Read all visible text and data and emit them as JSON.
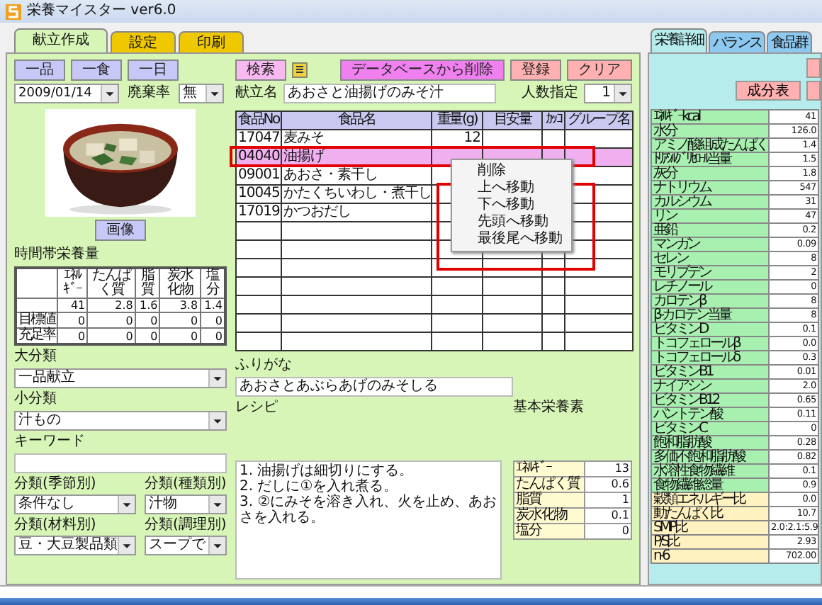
{
  "window": {
    "title": "栄養マイスター ver6.0"
  },
  "tabs": [
    {
      "label": "献立作成",
      "selected": true
    },
    {
      "label": "設定",
      "selected": false
    },
    {
      "label": "印刷",
      "selected": false
    }
  ],
  "period_buttons": [
    "一品",
    "一食",
    "一日"
  ],
  "search_button": "検索",
  "date": "2009/01/14",
  "waste_rate": {
    "label": "廃棄率",
    "value": "無"
  },
  "image_button": "画像",
  "time_nutrition": {
    "title": "時間帯栄養量",
    "columns": [
      "ｴﾈﾙｷﾞｰ",
      "たんぱく質",
      "脂質",
      "炭水化物",
      "塩分"
    ],
    "rows": [
      {
        "label": "",
        "values": [
          "41",
          "2.8",
          "1.6",
          "3.8",
          "1.4"
        ]
      },
      {
        "label": "目標値",
        "values": [
          "0",
          "0",
          "0",
          "0",
          "0"
        ]
      },
      {
        "label": "充足率",
        "values": [
          "0",
          "0",
          "0",
          "0",
          "0"
        ]
      }
    ]
  },
  "classification": [
    {
      "label": "大分類",
      "value": "一品献立",
      "kind": "dropdown"
    },
    {
      "label": "小分類",
      "value": "汁もの",
      "kind": "dropdown"
    },
    {
      "label": "キーワード",
      "kind": "text"
    }
  ],
  "sub_classification": [
    {
      "label": "分類(季節別)",
      "value": "条件なし"
    },
    {
      "label": "分類(種類別)",
      "value": "汁物"
    },
    {
      "label": "分類(材料別)",
      "value": "豆・大豆製品類"
    },
    {
      "label": "分類(調理別)",
      "value": "スープで"
    }
  ],
  "action_buttons": [
    {
      "label": "データベースから削除",
      "kind": "danger"
    },
    {
      "label": "登録",
      "kind": "normal"
    },
    {
      "label": "クリア",
      "kind": "normal"
    }
  ],
  "menu_name": {
    "label": "献立名",
    "value": "あおさと油揚げのみそ汁"
  },
  "servings": {
    "label": "人数指定",
    "value": "1"
  },
  "food_table": {
    "columns": [
      "食品No",
      "食品名",
      "重量(g)",
      "目安量",
      "ｶｯｺ",
      "グループ名"
    ],
    "rows": [
      {
        "no": "17047",
        "name": "麦みそ",
        "weight": "12",
        "selected": false
      },
      {
        "no": "04040",
        "name": "油揚げ",
        "selected": true
      },
      {
        "no": "09001",
        "name": "あおさ・素干し",
        "selected": false
      },
      {
        "no": "10045",
        "name": "かたくちいわし・煮干し",
        "selected": false
      },
      {
        "no": "17019",
        "name": "かつおだし",
        "selected": false
      }
    ]
  },
  "context_menu": [
    "削除",
    "上へ移動",
    "下へ移動",
    "先頭へ移動",
    "最後尾へ移動"
  ],
  "furigana": {
    "label": "ふりがな",
    "value": "あおさとあぶらあげのみそしる"
  },
  "recipe": {
    "label": "レシピ",
    "lines": [
      "1. 油揚げは細切りにする。",
      "2. だしに①を入れ煮る。",
      "3. ②にみそを溶き入れ、火を止め、あおさを入れる。"
    ]
  },
  "basic_nutrients": {
    "title": "基本栄養素",
    "rows": [
      {
        "name": "ｴﾈﾙｷﾞｰ",
        "value": "13"
      },
      {
        "name": "たんぱく質",
        "value": "0.6"
      },
      {
        "name": "脂質",
        "value": "1"
      },
      {
        "name": "炭水化物",
        "value": "0.1"
      },
      {
        "name": "塩分",
        "value": "0"
      }
    ]
  },
  "detail_tabs": [
    {
      "label": "栄養詳細",
      "selected": true
    },
    {
      "label": "バランス",
      "selected": false
    },
    {
      "label": "食品群",
      "selected": false
    }
  ],
  "detail_button": "成分表",
  "nutrient_details": [
    {
      "name": "ｴﾈﾙｷﾞｰkcal",
      "value": "41",
      "kind": "main"
    },
    {
      "name": "水分",
      "value": "126.0",
      "kind": "main"
    },
    {
      "name": "アミノ酸組成たんぱく",
      "value": "1.4",
      "kind": "main"
    },
    {
      "name": "ﾄﾘｱｼﾙｸﾞﾘｾﾛｰﾙ当量",
      "value": "1.5",
      "kind": "main"
    },
    {
      "name": "灰分",
      "value": "1.8",
      "kind": "main"
    },
    {
      "name": "ナトリウム",
      "value": "547",
      "kind": "main"
    },
    {
      "name": "カルシウム",
      "value": "31",
      "kind": "main"
    },
    {
      "name": "リン",
      "value": "47",
      "kind": "main"
    },
    {
      "name": "亜鉛",
      "value": "0.2",
      "kind": "main"
    },
    {
      "name": "マンガン",
      "value": "0.09",
      "kind": "main"
    },
    {
      "name": "セレン",
      "value": "8",
      "kind": "main"
    },
    {
      "name": "モリブデン",
      "value": "2",
      "kind": "main"
    },
    {
      "name": "レチノール",
      "value": "0",
      "kind": "main"
    },
    {
      "name": "カロテンβ",
      "value": "8",
      "kind": "main"
    },
    {
      "name": "β-カロテン当量",
      "value": "8",
      "kind": "main"
    },
    {
      "name": "ビタミンD",
      "value": "0.1",
      "kind": "main"
    },
    {
      "name": "トコフェロールβ",
      "value": "0.0",
      "kind": "main"
    },
    {
      "name": "トコフェロールδ",
      "value": "0.3",
      "kind": "main"
    },
    {
      "name": "ビタミンB1",
      "value": "0.01",
      "kind": "main"
    },
    {
      "name": "ナイアシン",
      "value": "2.0",
      "kind": "main"
    },
    {
      "name": "ビタミンB12",
      "value": "0.65",
      "kind": "main"
    },
    {
      "name": "パントテン酸",
      "value": "0.11",
      "kind": "main"
    },
    {
      "name": "ビタミンC",
      "value": "0",
      "kind": "main"
    },
    {
      "name": "飽和脂肪酸",
      "value": "0.28",
      "kind": "main"
    },
    {
      "name": "多価不飽和脂肪酸",
      "value": "0.82",
      "kind": "main"
    },
    {
      "name": "水溶性食物繊維",
      "value": "0.1",
      "kind": "main"
    },
    {
      "name": "食物繊維総量",
      "value": "0.9",
      "kind": "main"
    },
    {
      "name": "穀類エネルギー比",
      "value": "0.0",
      "kind": "ratio"
    },
    {
      "name": "動たんぱく比",
      "value": "10.7",
      "kind": "ratio"
    },
    {
      "name": "SMP比",
      "value": "2.0:2.1:5.9",
      "kind": "ratio"
    },
    {
      "name": "P/S比",
      "value": "2.93",
      "kind": "ratio"
    },
    {
      "name": "n-6",
      "value": "702.00",
      "kind": "ratio"
    }
  ]
}
